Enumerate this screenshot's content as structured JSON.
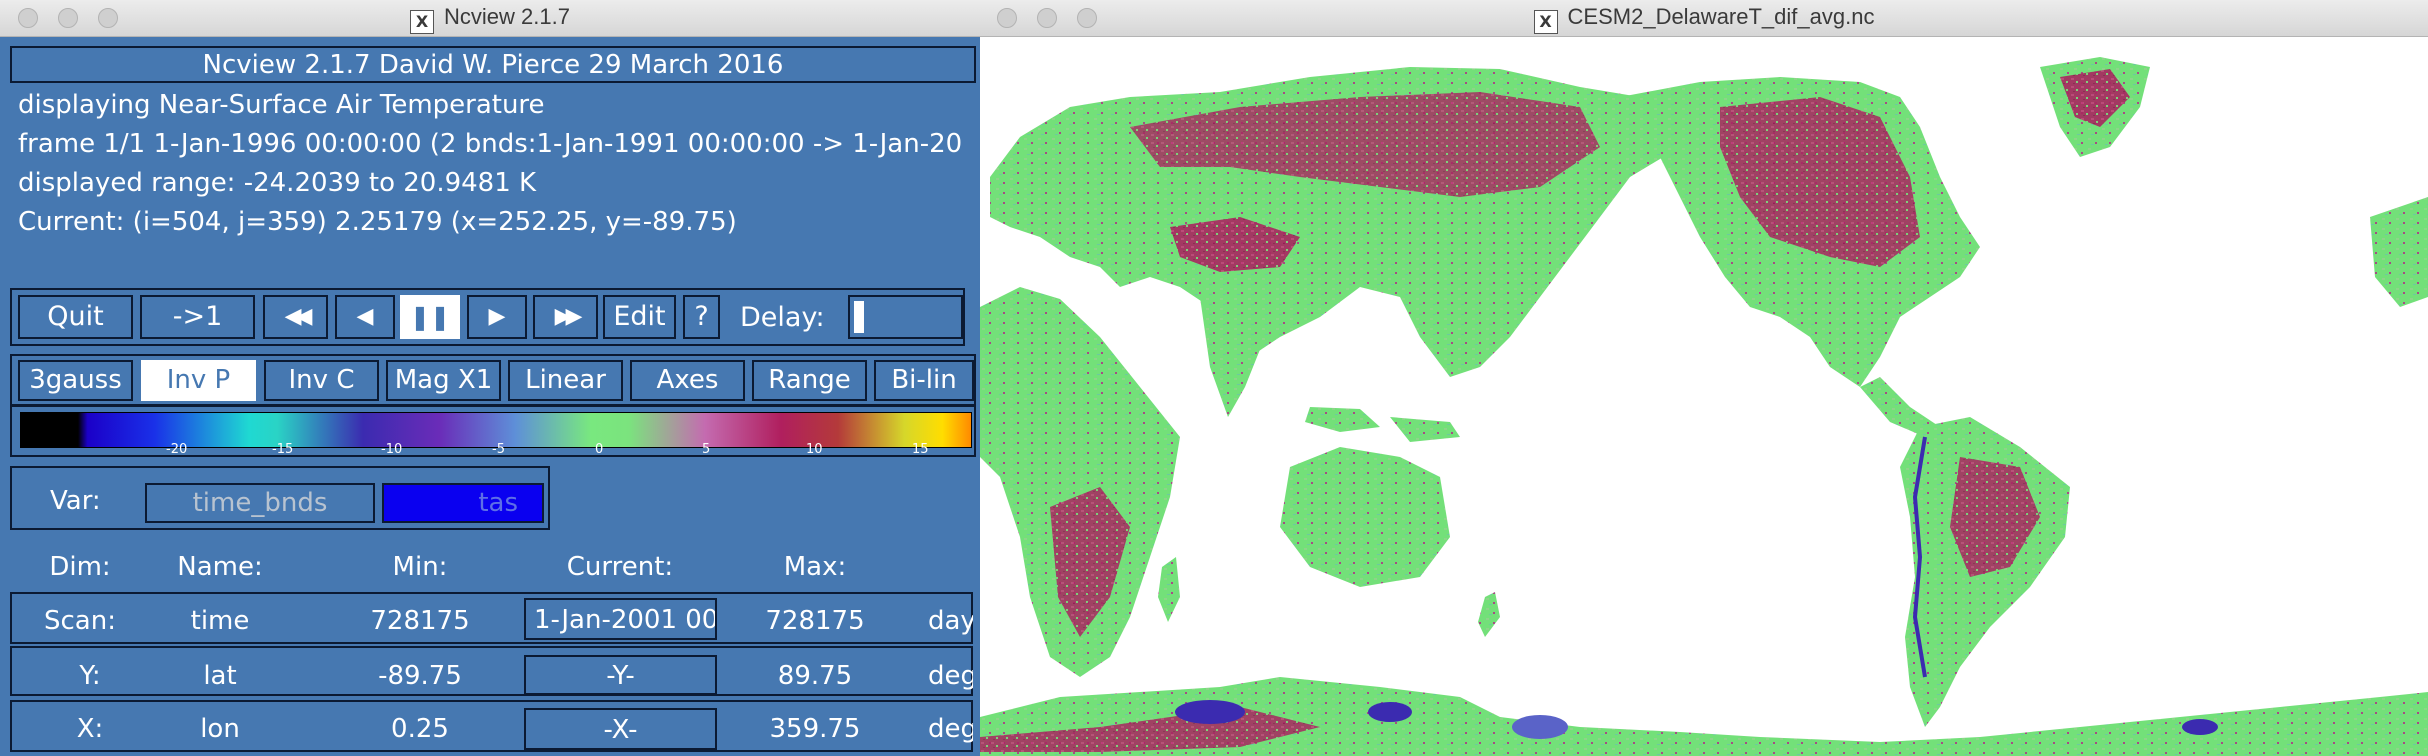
{
  "left_window": {
    "title": "Ncview 2.1.7",
    "header": "Ncview 2.1.7 David W. Pierce  29 March 2016",
    "info_lines": [
      "displaying Near-Surface Air Temperature",
      "frame 1/1 1-Jan-1996 00:00:00 (2 bnds:1-Jan-1991 00:00:00 -> 1-Jan-20",
      "displayed range: -24.2039 to 20.9481 K",
      "Current: (i=504, j=359) 2.25179 (x=252.25, y=-89.75)"
    ],
    "controls": {
      "quit": "Quit",
      "first": "->1",
      "rewind_icon": "◀◀",
      "back_icon": "◀",
      "pause_icon": "❚❚",
      "forward_icon": "▶",
      "fastforward_icon": "▶▶",
      "edit": "Edit",
      "help": "?",
      "delay": "Delay:"
    },
    "options": [
      "3gauss",
      "Inv P",
      "Inv C",
      "Mag X1",
      "Linear",
      "Axes",
      "Range",
      "Bi-lin"
    ],
    "selected_option": "Inv P",
    "colorbar_ticks": [
      "-20",
      "-15",
      "-10",
      "-5",
      "0",
      "5",
      "10",
      "15"
    ],
    "var_label": "Var:",
    "vars": [
      "time_bnds",
      "tas"
    ],
    "selected_var": "tas",
    "dim_headers": [
      "Dim:",
      "Name:",
      "Min:",
      "Current:",
      "Max:"
    ],
    "dims": [
      {
        "dim": "Scan:",
        "name": "time",
        "min": "728175",
        "current": "1-Jan-2001 00",
        "max": "728175",
        "units": "day"
      },
      {
        "dim": "Y:",
        "name": "lat",
        "min": "-89.75",
        "current": "-Y-",
        "max": "89.75",
        "units": "deg"
      },
      {
        "dim": "X:",
        "name": "lon",
        "min": "0.25",
        "current": "-X-",
        "max": "359.75",
        "units": "deg"
      }
    ]
  },
  "right_window": {
    "title": "CESM2_DelawareT_dif_avg.nc"
  },
  "colors": {
    "panel_bg": "#4678b1",
    "land_neutral": "#73e079",
    "land_warm": "#b0205e",
    "land_cool": "#5a63c8",
    "selected_var_bg": "#0a00f0",
    "ocean": "#ffffff"
  }
}
